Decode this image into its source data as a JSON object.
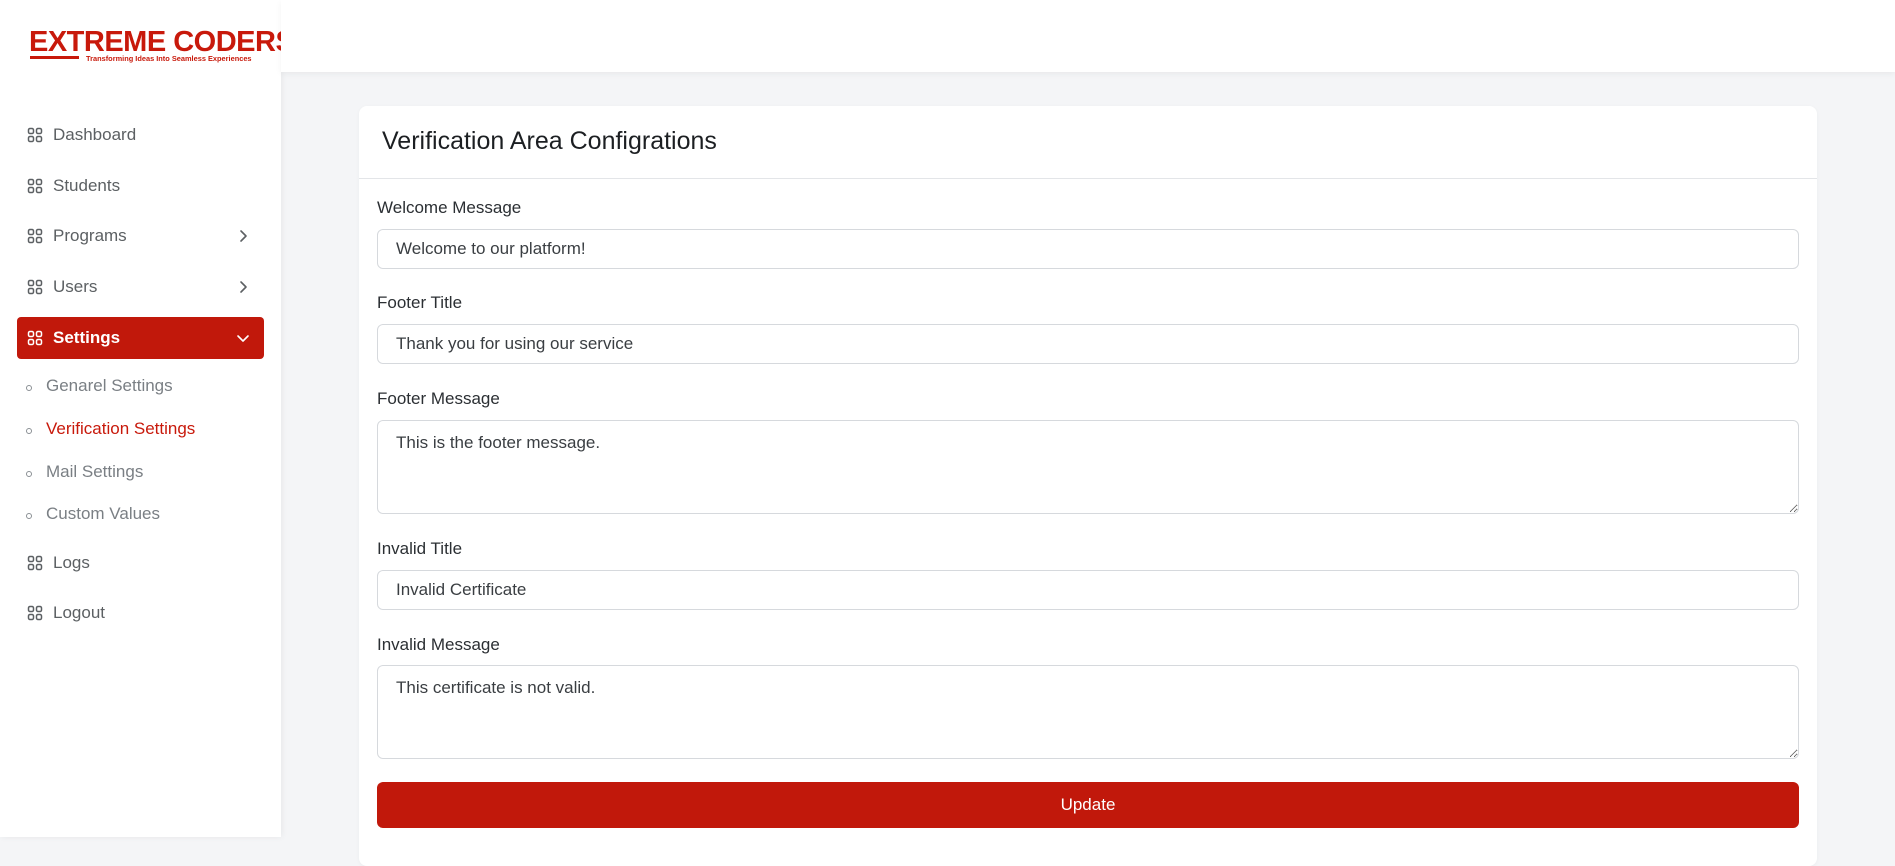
{
  "brand": {
    "name": "EXTREME CODERS",
    "tagline": "Transforming Ideas Into Seamless Experiences",
    "color": "#c8190b"
  },
  "sidebar": {
    "items": [
      {
        "label": "Dashboard",
        "icon": "grid-icon"
      },
      {
        "label": "Students",
        "icon": "grid-icon"
      },
      {
        "label": "Programs",
        "icon": "grid-icon",
        "chevron": "right"
      },
      {
        "label": "Users",
        "icon": "grid-icon",
        "chevron": "right"
      },
      {
        "label": "Settings",
        "icon": "grid-icon",
        "chevron": "down",
        "active": true,
        "children": [
          {
            "label": "Genarel Settings"
          },
          {
            "label": "Verification Settings",
            "active": true
          },
          {
            "label": "Mail Settings"
          },
          {
            "label": "Custom Values"
          }
        ]
      },
      {
        "label": "Logs",
        "icon": "grid-icon"
      },
      {
        "label": "Logout",
        "icon": "grid-icon"
      }
    ]
  },
  "card": {
    "title": "Verification Area Configrations"
  },
  "form": {
    "welcome_label": "Welcome Message",
    "welcome_value": "Welcome to our platform!",
    "footer_title_label": "Footer Title",
    "footer_title_value": "Thank you for using our service",
    "footer_message_label": "Footer Message",
    "footer_message_value": "This is the footer message.",
    "invalid_title_label": "Invalid Title",
    "invalid_title_value": "Invalid Certificate",
    "invalid_message_label": "Invalid Message",
    "invalid_message_value": "This certificate is not valid.",
    "submit_label": "Update"
  },
  "colors": {
    "accent": "#c1180b",
    "background": "#f4f5f7"
  }
}
